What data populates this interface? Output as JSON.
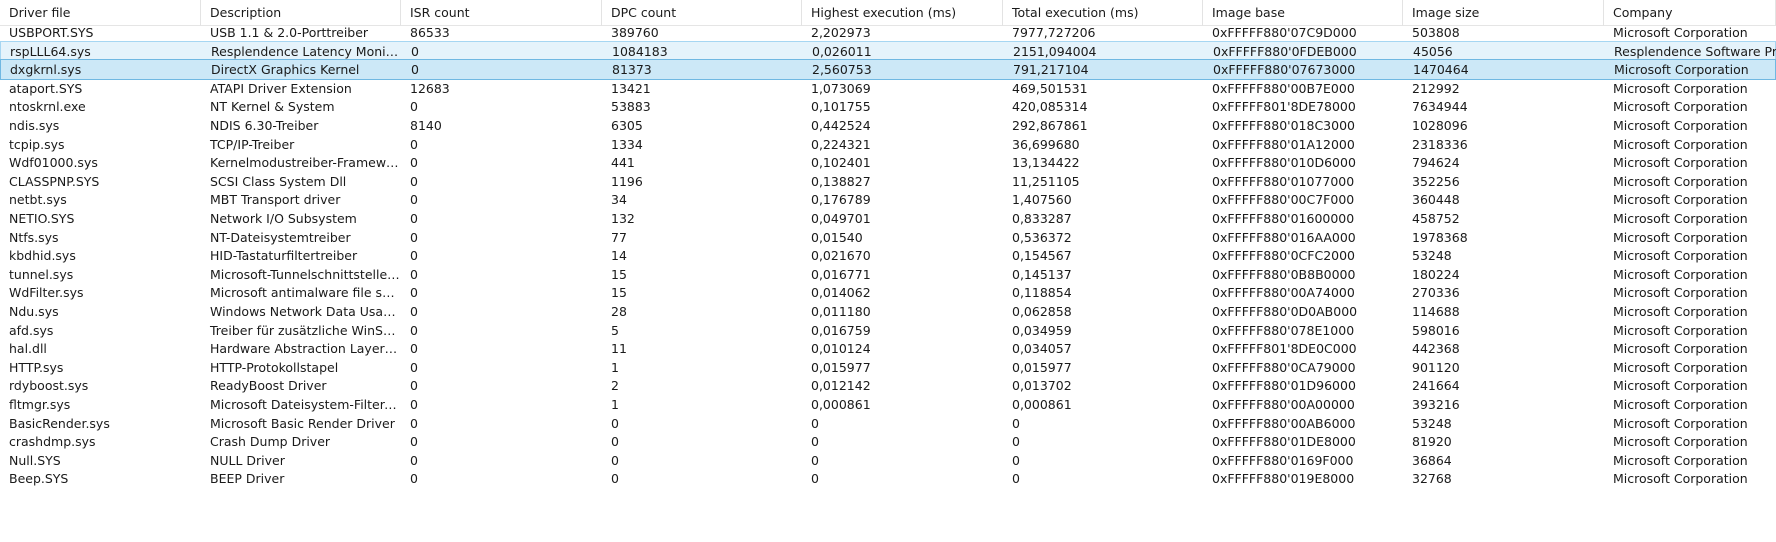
{
  "columns": [
    "Driver file",
    "Description",
    "ISR count",
    "DPC count",
    "Highest execution (ms)",
    "Total execution (ms)",
    "Image base",
    "Image size",
    "Company"
  ],
  "rows": [
    [
      "USBPORT.SYS",
      "USB 1.1 & 2.0-Porttreiber",
      "86533",
      "389760",
      "2,202973",
      "7977,727206",
      "0xFFFFF880'07C9D000",
      "503808",
      "Microsoft Corporation"
    ],
    [
      "rspLLL64.sys",
      "Resplendence Latency Monitoring and Auxiliary Kernel Library",
      "0",
      "1084183",
      "0,026011",
      "2151,094004",
      "0xFFFFF880'0FDEB000",
      "45056",
      "Resplendence Software Projects Sp."
    ],
    [
      "dxgkrnl.sys",
      "DirectX Graphics Kernel",
      "0",
      "81373",
      "2,560753",
      "791,217104",
      "0xFFFFF880'07673000",
      "1470464",
      "Microsoft Corporation"
    ],
    [
      "ataport.SYS",
      "ATAPI Driver Extension",
      "12683",
      "13421",
      "1,073069",
      "469,501531",
      "0xFFFFF880'00B7E000",
      "212992",
      "Microsoft Corporation"
    ],
    [
      "ntoskrnl.exe",
      "NT Kernel & System",
      "0",
      "53883",
      "0,101755",
      "420,085314",
      "0xFFFFF801'8DE78000",
      "7634944",
      "Microsoft Corporation"
    ],
    [
      "ndis.sys",
      "NDIS 6.30-Treiber",
      "8140",
      "6305",
      "0,442524",
      "292,867861",
      "0xFFFFF880'018C3000",
      "1028096",
      "Microsoft Corporation"
    ],
    [
      "tcpip.sys",
      "TCP/IP-Treiber",
      "0",
      "1334",
      "0,224321",
      "36,699680",
      "0xFFFFF880'01A12000",
      "2318336",
      "Microsoft Corporation"
    ],
    [
      "Wdf01000.sys",
      "Kernelmodustreiber-Framework-Laufzeit",
      "0",
      "441",
      "0,102401",
      "13,134422",
      "0xFFFFF880'010D6000",
      "794624",
      "Microsoft Corporation"
    ],
    [
      "CLASSPNP.SYS",
      "SCSI Class System Dll",
      "0",
      "1196",
      "0,138827",
      "11,251105",
      "0xFFFFF880'01077000",
      "352256",
      "Microsoft Corporation"
    ],
    [
      "netbt.sys",
      "MBT Transport driver",
      "0",
      "34",
      "0,176789",
      "1,407560",
      "0xFFFFF880'00C7F000",
      "360448",
      "Microsoft Corporation"
    ],
    [
      "NETIO.SYS",
      "Network I/O Subsystem",
      "0",
      "132",
      "0,049701",
      "0,833287",
      "0xFFFFF880'01600000",
      "458752",
      "Microsoft Corporation"
    ],
    [
      "Ntfs.sys",
      "NT-Dateisystemtreiber",
      "0",
      "77",
      "0,01540",
      "0,536372",
      "0xFFFFF880'016AA000",
      "1978368",
      "Microsoft Corporation"
    ],
    [
      "kbdhid.sys",
      "HID-Tastaturfiltertreiber",
      "0",
      "14",
      "0,021670",
      "0,154567",
      "0xFFFFF880'0CFC2000",
      "53248",
      "Microsoft Corporation"
    ],
    [
      "tunnel.sys",
      "Microsoft-Tunnelschnittstellentreiber",
      "0",
      "15",
      "0,016771",
      "0,145137",
      "0xFFFFF880'0B8B0000",
      "180224",
      "Microsoft Corporation"
    ],
    [
      "WdFilter.sys",
      "Microsoft antimalware file system filter driver",
      "0",
      "15",
      "0,014062",
      "0,118854",
      "0xFFFFF880'00A74000",
      "270336",
      "Microsoft Corporation"
    ],
    [
      "Ndu.sys",
      "Windows Network Data Usage Monitoring Driver",
      "0",
      "28",
      "0,011180",
      "0,062858",
      "0xFFFFF880'0D0AB000",
      "114688",
      "Microsoft Corporation"
    ],
    [
      "afd.sys",
      "Treiber für zusätzliche WinSock-Funktionen",
      "0",
      "5",
      "0,016759",
      "0,034959",
      "0xFFFFF880'078E1000",
      "598016",
      "Microsoft Corporation"
    ],
    [
      "hal.dll",
      "Hardware Abstraction Layer DLL",
      "0",
      "11",
      "0,010124",
      "0,034057",
      "0xFFFFF801'8DE0C000",
      "442368",
      "Microsoft Corporation"
    ],
    [
      "HTTP.sys",
      "HTTP-Protokollstapel",
      "0",
      "1",
      "0,015977",
      "0,015977",
      "0xFFFFF880'0CA79000",
      "901120",
      "Microsoft Corporation"
    ],
    [
      "rdyboost.sys",
      "ReadyBoost Driver",
      "0",
      "2",
      "0,012142",
      "0,013702",
      "0xFFFFF880'01D96000",
      "241664",
      "Microsoft Corporation"
    ],
    [
      "fltmgr.sys",
      "Microsoft Dateisystem-Filter-Manager",
      "0",
      "1",
      "0,000861",
      "0,000861",
      "0xFFFFF880'00A00000",
      "393216",
      "Microsoft Corporation"
    ],
    [
      "BasicRender.sys",
      "Microsoft Basic Render Driver",
      "0",
      "0",
      "0",
      "0",
      "0xFFFFF880'00AB6000",
      "53248",
      "Microsoft Corporation"
    ],
    [
      "crashdmp.sys",
      "Crash Dump Driver",
      "0",
      "0",
      "0",
      "0",
      "0xFFFFF880'01DE8000",
      "81920",
      "Microsoft Corporation"
    ],
    [
      "Null.SYS",
      "NULL Driver",
      "0",
      "0",
      "0",
      "0",
      "0xFFFFF880'0169F000",
      "36864",
      "Microsoft Corporation"
    ],
    [
      "Beep.SYS",
      "BEEP Driver",
      "0",
      "0",
      "0",
      "0",
      "0xFFFFF880'019E8000",
      "32768",
      "Microsoft Corporation"
    ]
  ],
  "selected_rows": [
    1,
    2
  ],
  "focused_row": 2,
  "colors": {
    "selection_bg": "#e5f3fb",
    "selection_border": "#a6d6f2",
    "focus_bg": "#cce8f7",
    "focus_border": "#70b8e2"
  }
}
